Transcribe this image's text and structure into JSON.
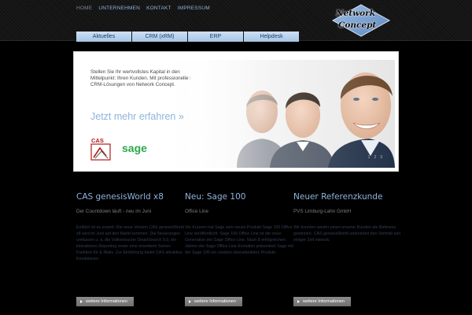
{
  "topnav": [
    "HOME",
    "UNTERNEHMEN",
    "KONTAKT",
    "IMPRESSUM"
  ],
  "logo": {
    "line1": "Network",
    "line2": "Concept"
  },
  "tabs": [
    "Aktuelles",
    "CRM (xRM)",
    "ERP",
    "Helpdesk"
  ],
  "banner": {
    "text": "Stellen Sie Ihr wertvollstes Kapital in den Mittelpunkt: Ihren Kunden. Mit professionellen CRM-Lösungen von Network Concept.",
    "cta": "Jetzt mehr erfahren »",
    "cas_logo": "CAS",
    "sage_logo": "sage",
    "pager": [
      "1",
      "2",
      "3"
    ]
  },
  "columns": [
    {
      "title": "CAS genesisWorld x8",
      "subtitle": "Der Countdown läuft - neu im Juni",
      "body": "Endlich ist es soweit: Die neue Version CAS genesisWorld x8 wird im Juni auf den Markt kommen. Die Neuerungen umfassen u. a. die Volltextsuche SmartSearch 5.0, ein interaktives Reporting sowie eine erweiterte Serien-Funktion für E-Mails. Zur Einführung bietet CAS attraktive Konditionen.",
      "button": "weitere Informationen"
    },
    {
      "title": "Neu: Sage 100",
      "subtitle": "Office Line",
      "body": "Vor Kurzem hat Sage sein neues Produkt Sage 100 Office Line veröffentlicht. Sage 100 Office Line ist die neue Generation der Sage Office Line. Nach 8 erfolgreichen Jahren der Sage Office Line Evolution präsentiert Sage mit der Sage 100 ein rundum überarbeitetes Produkt.",
      "button": "weitere Informationen"
    },
    {
      "title": "Neuer Referenzkunde",
      "subtitle": "PVS Limburg-Lahn GmbH",
      "body": "Wir konnten wieder einen unserer Kunden als Referenz gewinnen. CAS genesisWorld unterstützt den Vertrieb seit einiger Zeit intensiv.",
      "button": "weitere Informationen"
    }
  ]
}
